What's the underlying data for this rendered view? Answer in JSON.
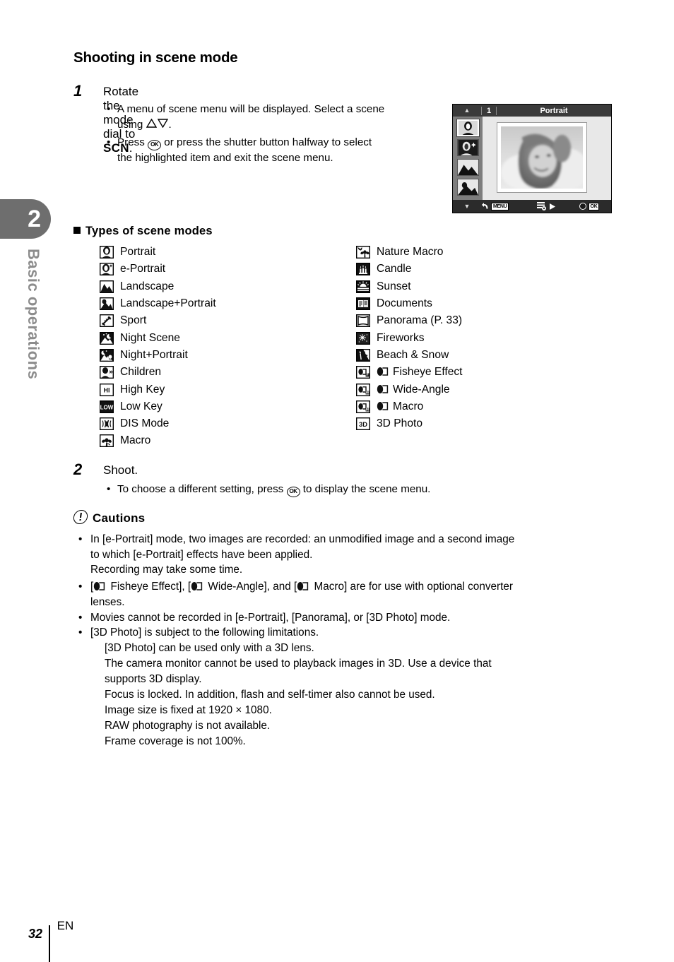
{
  "sidebar": {
    "chapter_number": "2",
    "chapter_label": "Basic operations"
  },
  "header": {
    "title": "Shooting in scene mode"
  },
  "steps": [
    {
      "number": "1",
      "title_prefix": "Rotate the mode dial to ",
      "title_bold": "SCN",
      "title_suffix": ".",
      "bullets": [
        "A menu of scene menu will be displayed. Select a scene",
        "using",
        "Press",
        "or press the shutter button halfway to select",
        "the highlighted item and exit the scene menu."
      ]
    },
    {
      "number": "2",
      "title": "Shoot.",
      "bullet_prefix": "To choose a different setting, press",
      "bullet_suffix": "to display the scene menu."
    }
  ],
  "lcd": {
    "page_indicator": "1",
    "title": "Portrait",
    "menu_badge": "MENU",
    "ok_badge": "OK",
    "up_arrow": "▲",
    "down_arrow": "▼",
    "back_arrow": "↶",
    "right_arrow": "▶",
    "icons": [
      {
        "name": "portrait-icon",
        "selected": true
      },
      {
        "name": "e-portrait-icon",
        "selected": false
      },
      {
        "name": "landscape-icon",
        "selected": false
      },
      {
        "name": "landscape-portrait-icon",
        "selected": false
      }
    ]
  },
  "scene_modes": {
    "heading": "Types of scene modes",
    "left_column": [
      {
        "icon": "portrait-icon",
        "label": "Portrait"
      },
      {
        "icon": "e-portrait-icon",
        "label": "e-Portrait"
      },
      {
        "icon": "landscape-icon",
        "label": "Landscape"
      },
      {
        "icon": "landscape-portrait-icon",
        "label": "Landscape+Portrait"
      },
      {
        "icon": "sport-icon",
        "label": "Sport"
      },
      {
        "icon": "night-scene-icon",
        "label": "Night Scene"
      },
      {
        "icon": "night-portrait-icon",
        "label": "Night+Portrait"
      },
      {
        "icon": "children-icon",
        "label": "Children"
      },
      {
        "icon": "high-key-icon",
        "label": "High Key"
      },
      {
        "icon": "low-key-icon",
        "label": "Low Key"
      },
      {
        "icon": "dis-mode-icon",
        "label": "DIS Mode"
      },
      {
        "icon": "macro-icon",
        "label": "Macro"
      }
    ],
    "right_column": [
      {
        "icon": "nature-macro-icon",
        "label": "Nature Macro",
        "lens": false
      },
      {
        "icon": "candle-icon",
        "label": "Candle",
        "lens": false
      },
      {
        "icon": "sunset-icon",
        "label": "Sunset",
        "lens": false
      },
      {
        "icon": "documents-icon",
        "label": "Documents",
        "lens": false
      },
      {
        "icon": "panorama-icon",
        "label": "Panorama (P. 33)",
        "lens": false
      },
      {
        "icon": "fireworks-icon",
        "label": "Fireworks",
        "lens": false
      },
      {
        "icon": "beach-snow-icon",
        "label": "Beach & Snow",
        "lens": false
      },
      {
        "icon": "converter-fisheye-icon",
        "label": "Fisheye Effect",
        "lens": true
      },
      {
        "icon": "converter-wide-icon",
        "label": "Wide-Angle",
        "lens": true
      },
      {
        "icon": "converter-macro-icon",
        "label": "Macro",
        "lens": true
      },
      {
        "icon": "3d-photo-icon",
        "label": "3D Photo",
        "lens": false
      }
    ]
  },
  "cautions": {
    "heading": "Cautions",
    "lines": [
      {
        "bullet": true,
        "indent": 0,
        "text": "In [e-Portrait] mode, two images are recorded: an unmodified image and a second image"
      },
      {
        "bullet": false,
        "indent": 0,
        "text": "to which [e-Portrait] effects have been applied."
      },
      {
        "bullet": false,
        "indent": 0,
        "text": "Recording may take some time."
      },
      {
        "bullet": true,
        "indent": 0,
        "lens_line": true,
        "text_a": "[",
        "text_b": " Fisheye Effect], [",
        "text_c": " Wide-Angle], and [",
        "text_d": " Macro] are for use with optional converter"
      },
      {
        "bullet": false,
        "indent": 0,
        "text": "lenses."
      },
      {
        "bullet": true,
        "indent": 0,
        "text": "Movies cannot be recorded in [e-Portrait], [Panorama], or [3D Photo] mode."
      },
      {
        "bullet": true,
        "indent": 0,
        "text": "[3D Photo] is subject to the following limitations."
      },
      {
        "bullet": false,
        "indent": 1,
        "text": "[3D Photo] can be used only with a 3D lens."
      },
      {
        "bullet": false,
        "indent": 1,
        "text": "The camera monitor cannot be used to playback images in 3D. Use a device that"
      },
      {
        "bullet": false,
        "indent": 1,
        "text": "supports 3D display."
      },
      {
        "bullet": false,
        "indent": 1,
        "text": "Focus is locked. In addition, flash and self-timer also cannot be used."
      },
      {
        "bullet": false,
        "indent": 1,
        "text": "Image size is fixed at 1920 × 1080."
      },
      {
        "bullet": false,
        "indent": 1,
        "text": "RAW photography is not available."
      },
      {
        "bullet": false,
        "indent": 1,
        "text": "Frame coverage is not 100%."
      }
    ]
  },
  "footer": {
    "page_number": "32",
    "language": "EN"
  },
  "colors": {
    "tab_gray": "#6e6e6e",
    "label_gray": "#8c8c8c",
    "heading_bar": "#d8d8d8",
    "lcd_dark": "#2b2b2b"
  }
}
